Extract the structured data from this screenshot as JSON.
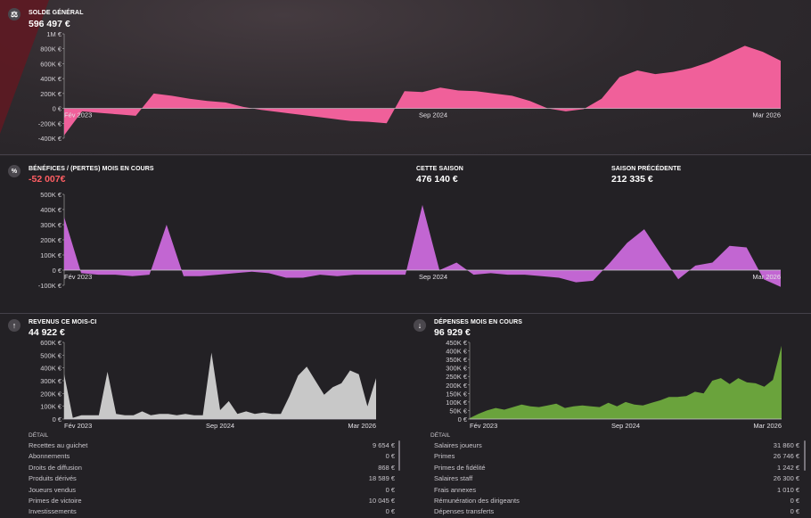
{
  "balance": {
    "icon": "scale-icon",
    "title": "SOLDE GÉNÉRAL",
    "value": "596 497 €",
    "y_ticks": [
      "1M €",
      "800K €",
      "600K €",
      "400K €",
      "200K €",
      "0 €",
      "-200K €",
      "-400K €"
    ],
    "x_ticks": [
      "Fév 2023",
      "Sep 2024",
      "Mar 2026"
    ]
  },
  "profit": {
    "icon": "percent-icon",
    "title": "BÉNÉFICES / (PERTES) MOIS EN COURS",
    "value": "-52 007€",
    "this_season_title": "CETTE SAISON",
    "this_season_value": "476 140 €",
    "prev_season_title": "SAISON PRÉCÉDENTE",
    "prev_season_value": "212 335 €",
    "y_ticks": [
      "500K €",
      "400K €",
      "300K €",
      "200K €",
      "100K €",
      "0 €",
      "-100K €"
    ],
    "x_ticks": [
      "Fév 2023",
      "Sep 2024",
      "Mar 2026"
    ]
  },
  "revenue": {
    "icon": "arrow-up-icon",
    "title": "REVENUS CE MOIS-CI",
    "value": "44 922 €",
    "y_ticks": [
      "600K €",
      "500K €",
      "400K €",
      "300K €",
      "200K €",
      "100K €",
      "0 €"
    ],
    "x_ticks": [
      "Fév 2023",
      "Sep 2024",
      "Mar 2026"
    ],
    "detail_title": "DÉTAIL",
    "rows": [
      {
        "label": "Recettes au guichet",
        "value": "9 654 €"
      },
      {
        "label": "Abonnements",
        "value": "0 €"
      },
      {
        "label": "Droits de diffusion",
        "value": "868 €"
      },
      {
        "label": "Produits dérivés",
        "value": "18 589 €"
      },
      {
        "label": "Joueurs vendus",
        "value": "0 €"
      },
      {
        "label": "Primes de victoire",
        "value": "10 045 €"
      },
      {
        "label": "Investissements",
        "value": "0 €"
      }
    ]
  },
  "expenses": {
    "icon": "arrow-down-icon",
    "title": "DÉPENSES MOIS EN COURS",
    "value": "96 929 €",
    "y_ticks": [
      "450K €",
      "400K €",
      "350K €",
      "300K €",
      "250K €",
      "200K €",
      "150K €",
      "100K €",
      "50K €",
      "0 €"
    ],
    "x_ticks": [
      "Fév 2023",
      "Sep 2024",
      "Mar 2026"
    ],
    "detail_title": "DÉTAIL",
    "rows": [
      {
        "label": "Salaires joueurs",
        "value": "31 860 €"
      },
      {
        "label": "Primes",
        "value": "26 746 €"
      },
      {
        "label": "Primes de fidélité",
        "value": "1 242 €"
      },
      {
        "label": "Salaires staff",
        "value": "26 300 €"
      },
      {
        "label": "Frais annexes",
        "value": "1 010 €"
      },
      {
        "label": "Rémunération des dirigeants",
        "value": "0 €"
      },
      {
        "label": "Dépenses transferts",
        "value": "0 €"
      }
    ]
  },
  "chart_data": [
    {
      "type": "area",
      "name": "balance",
      "color": "#f0609a",
      "ylim": [
        -400000,
        1000000
      ],
      "x": [
        "Fév 2023",
        "Sep 2024",
        "Mar 2026"
      ],
      "values": [
        -360000,
        -40000,
        -60000,
        -80000,
        -100000,
        200000,
        170000,
        130000,
        100000,
        80000,
        20000,
        -20000,
        -50000,
        -80000,
        -110000,
        -140000,
        -170000,
        -180000,
        -200000,
        230000,
        220000,
        280000,
        240000,
        230000,
        200000,
        170000,
        100000,
        0,
        -40000,
        -10000,
        130000,
        420000,
        510000,
        460000,
        490000,
        540000,
        620000,
        730000,
        840000,
        760000,
        640000
      ]
    },
    {
      "type": "area",
      "name": "profit",
      "color": "#c266d2",
      "ylim": [
        -100000,
        500000
      ],
      "x": [
        "Fév 2023",
        "Sep 2024",
        "Mar 2026"
      ],
      "values": [
        350000,
        -20000,
        -30000,
        -30000,
        -40000,
        -30000,
        300000,
        -40000,
        -40000,
        -30000,
        -20000,
        -10000,
        -20000,
        -50000,
        -50000,
        -30000,
        -40000,
        -30000,
        -30000,
        -30000,
        -30000,
        430000,
        0,
        50000,
        -30000,
        -20000,
        -30000,
        -30000,
        -40000,
        -50000,
        -80000,
        -70000,
        50000,
        180000,
        270000,
        100000,
        -60000,
        30000,
        50000,
        160000,
        150000,
        -60000,
        -110000
      ]
    },
    {
      "type": "area",
      "name": "revenue",
      "color": "#c8c8c8",
      "ylim": [
        0,
        600000
      ],
      "x": [
        "Fév 2023",
        "Sep 2024",
        "Mar 2026"
      ],
      "values": [
        350000,
        10000,
        30000,
        30000,
        30000,
        370000,
        40000,
        30000,
        30000,
        60000,
        30000,
        40000,
        40000,
        30000,
        40000,
        30000,
        30000,
        520000,
        70000,
        140000,
        40000,
        60000,
        40000,
        50000,
        40000,
        40000,
        180000,
        340000,
        410000,
        300000,
        190000,
        250000,
        280000,
        380000,
        350000,
        100000,
        320000
      ]
    },
    {
      "type": "area",
      "name": "expenses",
      "color": "#6aa33c",
      "ylim": [
        0,
        450000
      ],
      "x": [
        "Fév 2023",
        "Sep 2024",
        "Mar 2026"
      ],
      "values": [
        5000,
        30000,
        50000,
        65000,
        55000,
        70000,
        85000,
        75000,
        70000,
        80000,
        90000,
        65000,
        75000,
        80000,
        75000,
        70000,
        95000,
        75000,
        100000,
        85000,
        80000,
        95000,
        110000,
        130000,
        130000,
        135000,
        160000,
        150000,
        225000,
        240000,
        205000,
        240000,
        215000,
        210000,
        190000,
        230000,
        430000
      ]
    }
  ]
}
